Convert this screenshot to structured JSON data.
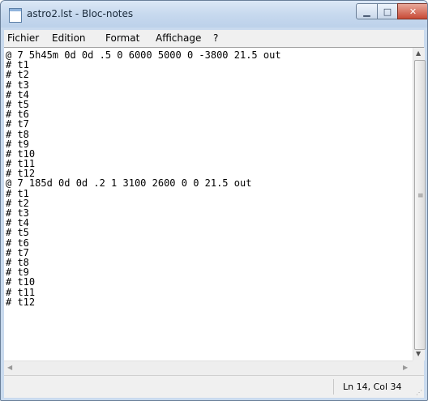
{
  "window": {
    "title": "astro2.lst - Bloc-notes",
    "controls": {
      "minimize": "▁",
      "maximize": "□",
      "close": "✕"
    }
  },
  "menu": [
    "Fichier",
    "Edition",
    "Format",
    "Affichage",
    "?"
  ],
  "content_lines": [
    "@ 7 5h45m 0d 0d .5 0 6000 5000 0 -3800 21.5 out",
    "# t1",
    "# t2",
    "# t3",
    "# t4",
    "# t5",
    "# t6",
    "# t7",
    "# t8",
    "# t9",
    "# t10",
    "# t11",
    "# t12",
    "@ 7 185d 0d 0d .2 1 3100 2600 0 0 21.5 out",
    "# t1",
    "# t2",
    "# t3",
    "# t4",
    "# t5",
    "# t6",
    "# t7",
    "# t8",
    "# t9",
    "# t10",
    "# t11",
    "# t12"
  ],
  "status": {
    "position": "Ln 14, Col 34"
  },
  "icons": {
    "app": "notepad-icon",
    "scroll_up": "▲",
    "scroll_down": "▼",
    "scroll_left": "◀",
    "scroll_right": "▶",
    "grip": "≡",
    "resize": "⋰"
  }
}
